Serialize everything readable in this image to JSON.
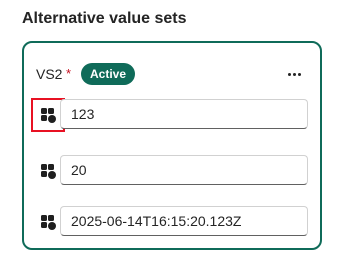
{
  "section": {
    "title": "Alternative value sets"
  },
  "value_set": {
    "name": "VS2",
    "required_marker": "*",
    "status": "Active",
    "more_icon": "more-horizontal-icon",
    "values": [
      {
        "value": "123",
        "handle_icon": "drag-handle-icon",
        "highlighted": true
      },
      {
        "value": "20",
        "handle_icon": "drag-handle-icon",
        "highlighted": false
      },
      {
        "value": "2025-06-14T16:15:20.123Z",
        "handle_icon": "drag-handle-icon",
        "highlighted": false
      }
    ]
  },
  "colors": {
    "accent": "#0f6b59",
    "required": "#c50f1f",
    "highlight": "#e81123"
  }
}
